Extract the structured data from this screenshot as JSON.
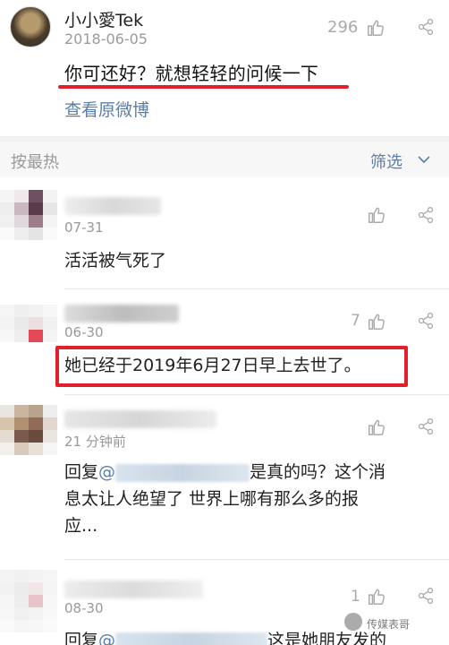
{
  "post": {
    "username": "小小愛Tek",
    "date": "2018-06-05",
    "likes": "296",
    "text": "你可还好？就想轻轻的问候一下",
    "view_original": "查看原微博"
  },
  "filter_bar": {
    "sort_label": "按最热",
    "filter_label": "筛选"
  },
  "comments": [
    {
      "date": "07-31",
      "likes": "",
      "text": "活活被气死了"
    },
    {
      "date": "06-30",
      "likes": "7",
      "text": "她已经于2019年6月27日早上去世了。"
    },
    {
      "date": "21 分钟前",
      "likes": "",
      "reply_prefix": "回复",
      "at": "@",
      "text_after": "是真的吗？这个消",
      "line2": "息太让人绝望了 世界上哪有那么多的报",
      "line3": "应..."
    },
    {
      "date": "08-30",
      "likes": "1",
      "reply_prefix": "回复",
      "at": "@",
      "text_after": "这是她朋友发的"
    }
  ],
  "watermark": "传媒表哥",
  "colors": {
    "accent_red": "#e2202b",
    "link_blue": "#5b7da6"
  }
}
